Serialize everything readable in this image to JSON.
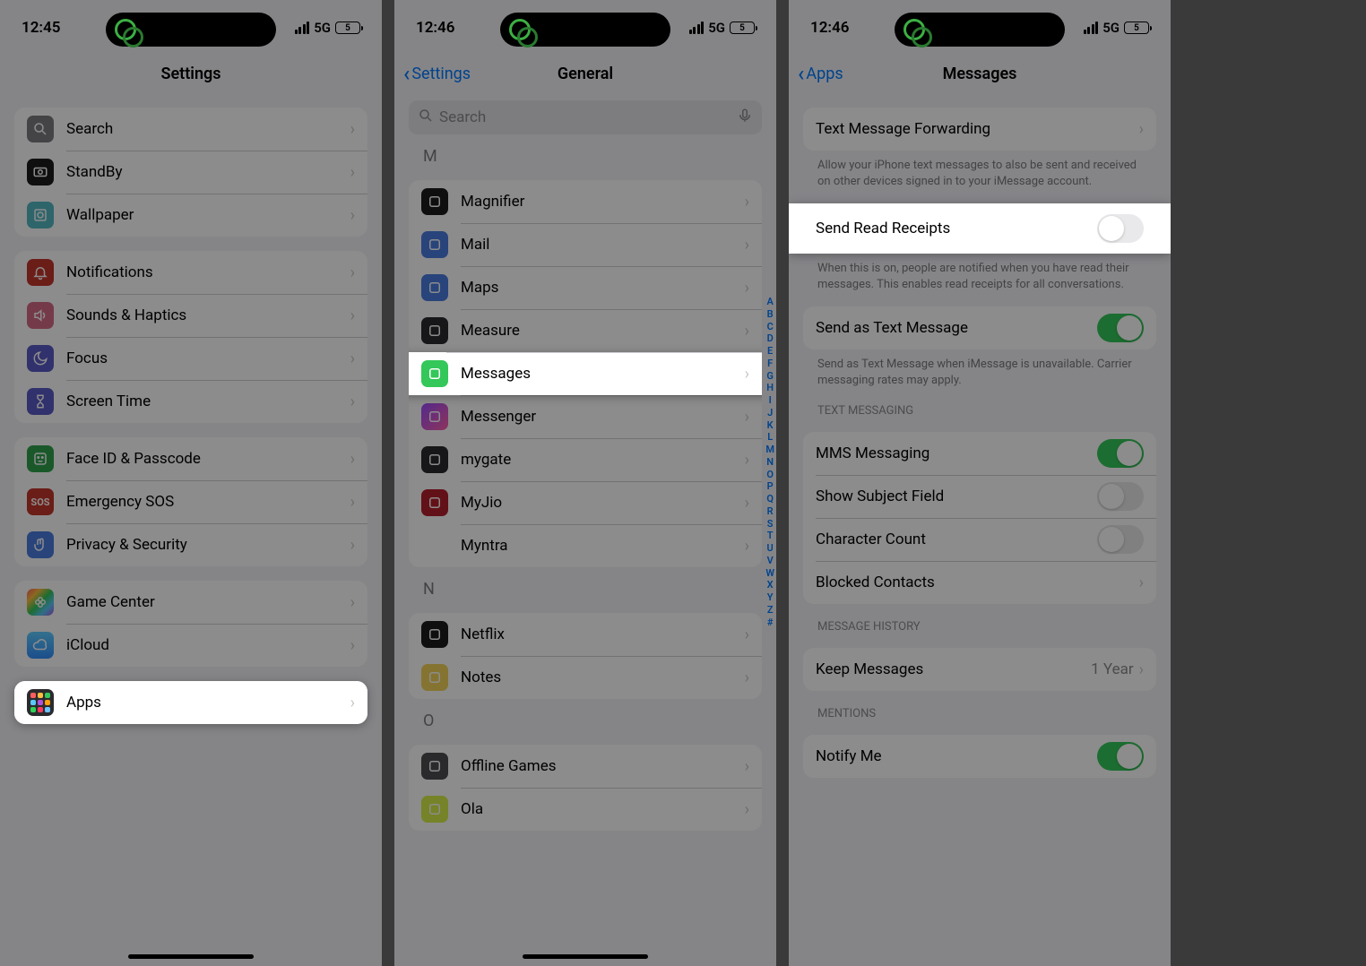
{
  "screen1": {
    "time": "12:45",
    "network": "5G",
    "battery": "5",
    "title": "Settings",
    "groups": [
      {
        "items": [
          {
            "id": "search",
            "label": "Search",
            "icon": "search-icon",
            "bg": "ic-gray"
          },
          {
            "id": "standby",
            "label": "StandBy",
            "icon": "standby-icon",
            "bg": "ic-black"
          },
          {
            "id": "wallpaper",
            "label": "Wallpaper",
            "icon": "wallpaper-icon",
            "bg": "ic-teal"
          }
        ]
      },
      {
        "items": [
          {
            "id": "notifications",
            "label": "Notifications",
            "icon": "bell-icon",
            "bg": "ic-red"
          },
          {
            "id": "sounds",
            "label": "Sounds & Haptics",
            "icon": "speaker-icon",
            "bg": "ic-pink"
          },
          {
            "id": "focus",
            "label": "Focus",
            "icon": "moon-icon",
            "bg": "ic-indigo"
          },
          {
            "id": "screentime",
            "label": "Screen Time",
            "icon": "hourglass-icon",
            "bg": "ic-indigo"
          }
        ]
      },
      {
        "items": [
          {
            "id": "faceid",
            "label": "Face ID & Passcode",
            "icon": "faceid-icon",
            "bg": "ic-green"
          },
          {
            "id": "sos",
            "label": "Emergency SOS",
            "icon": "sos-icon",
            "bg": "ic-red"
          },
          {
            "id": "privacy",
            "label": "Privacy & Security",
            "icon": "hand-icon",
            "bg": "ic-blue"
          }
        ]
      },
      {
        "items": [
          {
            "id": "gamecenter",
            "label": "Game Center",
            "icon": "gamecenter-icon",
            "bg": "ic-multi"
          },
          {
            "id": "icloud",
            "label": "iCloud",
            "icon": "cloud-icon",
            "bg": "ic-cloud"
          }
        ]
      },
      {
        "items": [
          {
            "id": "apps",
            "label": "Apps",
            "icon": "apps-icon",
            "bg": "ic-dark",
            "highlight": true
          }
        ]
      }
    ]
  },
  "screen2": {
    "time": "12:46",
    "network": "5G",
    "battery": "5",
    "back": "Settings",
    "title": "General",
    "search_placeholder": "Search",
    "index": [
      "A",
      "B",
      "C",
      "D",
      "E",
      "F",
      "G",
      "H",
      "I",
      "J",
      "K",
      "L",
      "M",
      "N",
      "O",
      "P",
      "Q",
      "R",
      "S",
      "T",
      "U",
      "V",
      "W",
      "X",
      "Y",
      "Z",
      "#"
    ],
    "sections": [
      {
        "header": "M",
        "items": [
          {
            "id": "magnifier",
            "label": "Magnifier",
            "bg": "ic-black"
          },
          {
            "id": "mail",
            "label": "Mail",
            "bg": "ic-blue"
          },
          {
            "id": "maps",
            "label": "Maps",
            "bg": "ic-blue"
          },
          {
            "id": "measure",
            "label": "Measure",
            "bg": "ic-dark"
          },
          {
            "id": "messages",
            "label": "Messages",
            "bg": "ic-msg",
            "highlight": true
          },
          {
            "id": "messenger",
            "label": "Messenger",
            "bg": "ic-mess"
          },
          {
            "id": "mygate",
            "label": "mygate",
            "bg": "ic-dark"
          },
          {
            "id": "myjio",
            "label": "MyJio",
            "bg": "ic-jio"
          },
          {
            "id": "myntra",
            "label": "Myntra",
            "bg": "ic-myntra"
          }
        ]
      },
      {
        "header": "N",
        "items": [
          {
            "id": "netflix",
            "label": "Netflix",
            "bg": "ic-netflix"
          },
          {
            "id": "notes",
            "label": "Notes",
            "bg": "ic-notes"
          }
        ]
      },
      {
        "header": "O",
        "items": [
          {
            "id": "offlinegames",
            "label": "Offline Games",
            "bg": "ic-offline"
          },
          {
            "id": "ola",
            "label": "Ola",
            "bg": "ic-ola"
          }
        ]
      }
    ]
  },
  "screen3": {
    "time": "12:46",
    "network": "5G",
    "battery": "5",
    "back": "Apps",
    "title": "Messages",
    "forwarding": {
      "label": "Text Message Forwarding",
      "footer": "Allow your iPhone text messages to also be sent and received on other devices signed in to your iMessage account."
    },
    "readreceipts": {
      "label": "Send Read Receipts",
      "on": false,
      "footer": "When this is on, people are notified when you have read their messages. This enables read receipts for all conversations."
    },
    "sendastext": {
      "label": "Send as Text Message",
      "on": true,
      "footer": "Send as Text Message when iMessage is unavailable. Carrier messaging rates may apply."
    },
    "textmessaging_header": "TEXT MESSAGING",
    "textmessaging": [
      {
        "id": "mms",
        "label": "MMS Messaging",
        "type": "switch",
        "on": true
      },
      {
        "id": "subject",
        "label": "Show Subject Field",
        "type": "switch",
        "on": false
      },
      {
        "id": "charcount",
        "label": "Character Count",
        "type": "switch",
        "on": false
      },
      {
        "id": "blocked",
        "label": "Blocked Contacts",
        "type": "chevron"
      }
    ],
    "history_header": "MESSAGE HISTORY",
    "keep": {
      "label": "Keep Messages",
      "value": "1 Year"
    },
    "mentions_header": "MENTIONS",
    "notify": {
      "label": "Notify Me",
      "on": true
    }
  }
}
